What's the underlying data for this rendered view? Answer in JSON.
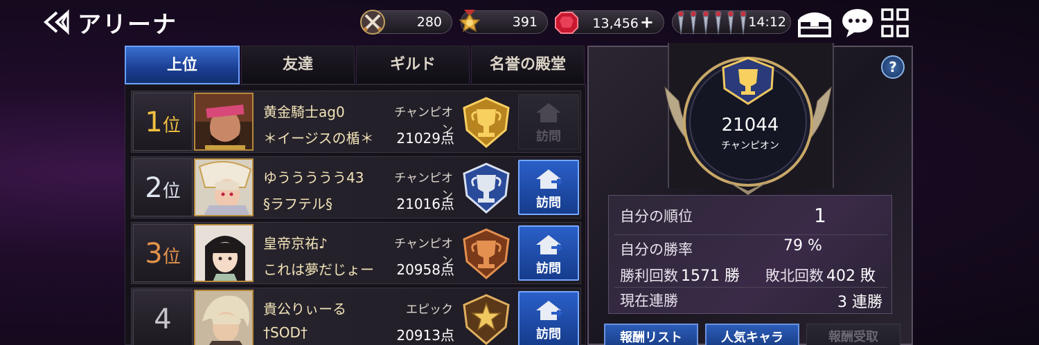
{
  "header": {
    "title": "アリーナ",
    "back_icon": "back-arrow-icon",
    "currencies": [
      {
        "name": "swords-icon",
        "value": "280"
      },
      {
        "name": "medal-icon",
        "value": "391"
      },
      {
        "name": "gem-icon",
        "value": "13,456",
        "suffix": "+"
      },
      {
        "name": "key-icon",
        "value": "14:12",
        "keys_count": 6
      }
    ],
    "icons": [
      "chest-icon",
      "chat-icon",
      "menu-grid-icon"
    ]
  },
  "tabs": [
    {
      "label": "上位",
      "active": true
    },
    {
      "label": "友達",
      "active": false
    },
    {
      "label": "ギルド",
      "active": false
    },
    {
      "label": "名誉の殿堂",
      "active": false
    }
  ],
  "rankings": [
    {
      "rank": "1",
      "rank_suffix": "位",
      "style": "gold",
      "name": "黄金騎士ag0",
      "title": "チャンピオン",
      "guild": "＊イージスの楯＊",
      "score": "21029点",
      "emblem": "gold-trophy-emblem",
      "visit_label": "訪問",
      "visit_enabled": false
    },
    {
      "rank": "2",
      "rank_suffix": "位",
      "style": "silver",
      "name": "ゆううううう43",
      "title": "チャンピオン",
      "guild": "§ラフテル§",
      "score": "21016点",
      "emblem": "silver-trophy-emblem",
      "visit_label": "訪問",
      "visit_enabled": true
    },
    {
      "rank": "3",
      "rank_suffix": "位",
      "style": "bronze",
      "name": "皇帝京祐♪",
      "title": "チャンピオン",
      "guild": "これは夢だじょー",
      "score": "20958点",
      "emblem": "bronze-trophy-emblem",
      "visit_label": "訪問",
      "visit_enabled": true
    },
    {
      "rank": "4",
      "rank_suffix": "",
      "style": "plain",
      "name": "貴公りぃーる",
      "title": "エピック",
      "guild": "†SOD†",
      "score": "20913点",
      "emblem": "epic-star-emblem",
      "visit_label": "訪問",
      "visit_enabled": true
    }
  ],
  "profile": {
    "score": "21044",
    "tier": "チャンピオン",
    "help_label": "?",
    "stats": {
      "rank_label": "自分の順位",
      "rank_value": "1",
      "winrate_label": "自分の勝率",
      "winrate_value": "79 %",
      "wins_label": "勝利回数",
      "wins_value": "1571 勝",
      "losses_label": "敗北回数",
      "losses_value": "402 敗",
      "streak_label": "現在連勝",
      "streak_value": "3 連勝"
    }
  },
  "bottom_buttons": [
    {
      "label": "報酬リスト",
      "enabled": true
    },
    {
      "label": "人気キャラ",
      "enabled": true
    },
    {
      "label": "報酬受取",
      "enabled": false
    }
  ],
  "colors": {
    "accent_blue": "#2a5fc8",
    "gold": "#f0c040",
    "silver": "#dfe6f0",
    "bronze": "#e4934a"
  }
}
